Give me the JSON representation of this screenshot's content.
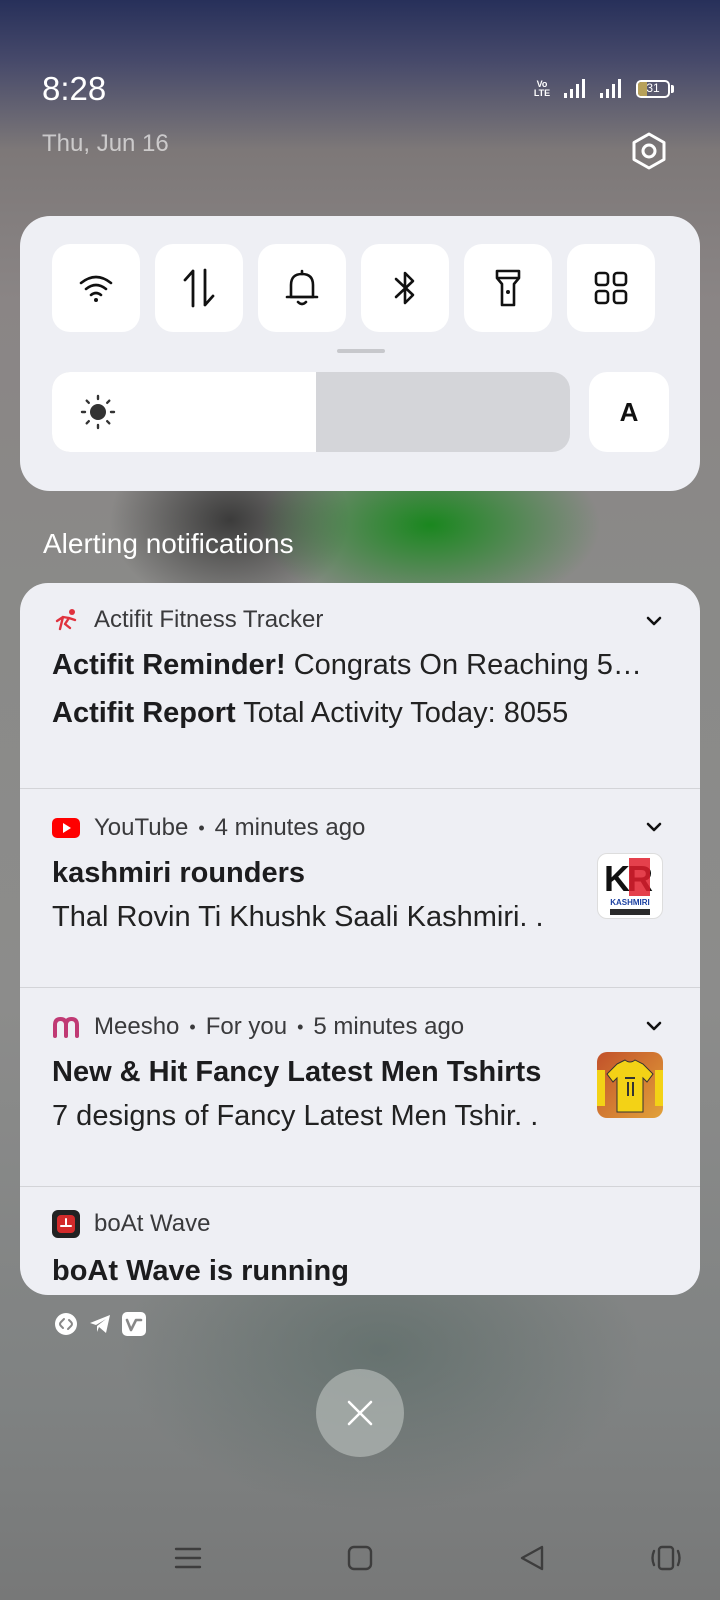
{
  "status_bar": {
    "time": "8:28",
    "date": "Thu, Jun 16",
    "volte_top": "Vo",
    "volte_bottom": "LTE",
    "battery_level": "31"
  },
  "quick_settings": {
    "tiles": [
      "wifi",
      "mobile-data",
      "sound",
      "bluetooth",
      "flashlight",
      "more"
    ],
    "brightness_percent": 51,
    "auto_label": "A"
  },
  "notifications_heading": "Alerting notifications",
  "notifications": [
    {
      "app": "Actifit Fitness Tracker",
      "lines": [
        {
          "bold": "Actifit Reminder!",
          "text": " Congrats On Reaching 5…"
        },
        {
          "bold": "Actifit Report",
          "text": " Total Activity Today: 8055"
        }
      ]
    },
    {
      "app": "YouTube",
      "time": "4 minutes ago",
      "title": "kashmiri rounders",
      "body": "Thal Rovin Ti Khushk Saali Kashmiri. .",
      "thumb_text_top": "KR",
      "thumb_text_bottom": "KASHMIRI"
    },
    {
      "app": "Meesho",
      "channel": "For you",
      "time": "5 minutes ago",
      "title": "New & Hit Fancy Latest Men Tshirts",
      "body": "7 designs of Fancy Latest Men Tshir. ."
    },
    {
      "app": "boAt Wave",
      "title": "boAt Wave is running"
    }
  ],
  "colors": {
    "panel_bg": "#eeeff4",
    "youtube_red": "#ff0000",
    "meesho_pink": "#c03a74",
    "actifit_red": "#e0323e"
  }
}
